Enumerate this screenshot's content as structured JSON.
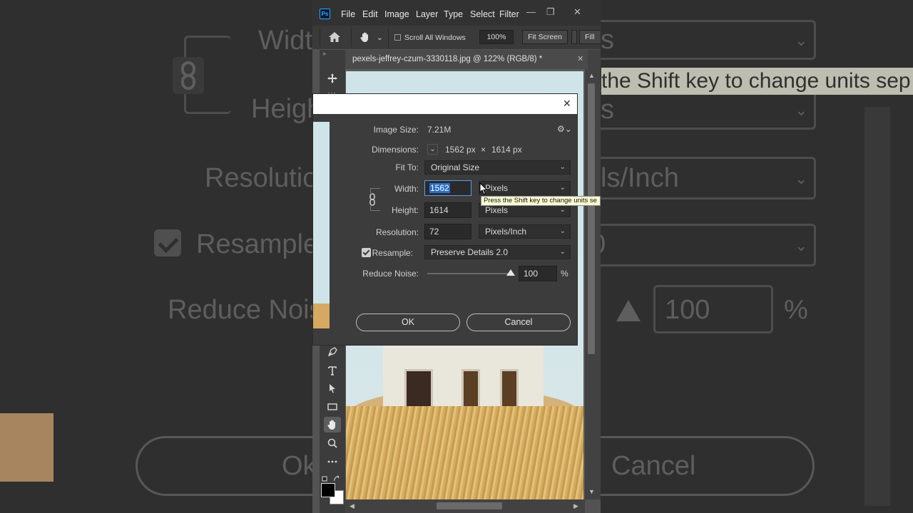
{
  "colors": {
    "ps_blue": "#31a8ff",
    "selection": "#2a6ec6",
    "tooltip_bg": "#fcfcd2"
  },
  "background": {
    "width_label": "Width",
    "height_label": "Heigh",
    "resolution_label": "Resolutio",
    "resample_label": "Resample",
    "reduce_noise_label": "Reduce Nois",
    "ok_label": "Ok",
    "right_row1": "s",
    "right_row2": "s",
    "right_resolution": "ls/Inch",
    "right_resample": "0",
    "right_noise_value": "100",
    "right_percent": "%",
    "right_cancel": "Cancel",
    "tooltip_text": "the Shift key to change units sep"
  },
  "app": {
    "logo": "Ps",
    "menu": [
      "File",
      "Edit",
      "Image",
      "Layer",
      "Type",
      "Select",
      "Filter"
    ],
    "options": {
      "scroll_all_windows": "Scroll All Windows",
      "zoom": "100%",
      "fit_screen": "Fit Screen",
      "fill": "Fill"
    },
    "document_tab": "pexels-jeffrey-czum-3330118.jpg @ 122% (RGB/8) *"
  },
  "dialog": {
    "image_size_label": "Image Size:",
    "image_size_value": "7.21M",
    "dimensions_label": "Dimensions:",
    "dimensions_width": "1562 px",
    "dimensions_x": "×",
    "dimensions_height": "1614 px",
    "fit_to_label": "Fit To:",
    "fit_to_value": "Original Size",
    "width_label": "Width:",
    "width_value": "1562",
    "width_unit": "Pixels",
    "height_label": "Height:",
    "height_value": "1614",
    "height_unit": "Pixels",
    "resolution_label": "Resolution:",
    "resolution_value": "72",
    "resolution_unit": "Pixels/Inch",
    "resample_label": "Resample:",
    "resample_checked": true,
    "resample_value": "Preserve Details 2.0",
    "reduce_noise_label": "Reduce Noise:",
    "reduce_noise_value": "100",
    "reduce_noise_percent": "%",
    "ok_label": "OK",
    "cancel_label": "Cancel",
    "tooltip": "Press the Shift key to change units se"
  }
}
